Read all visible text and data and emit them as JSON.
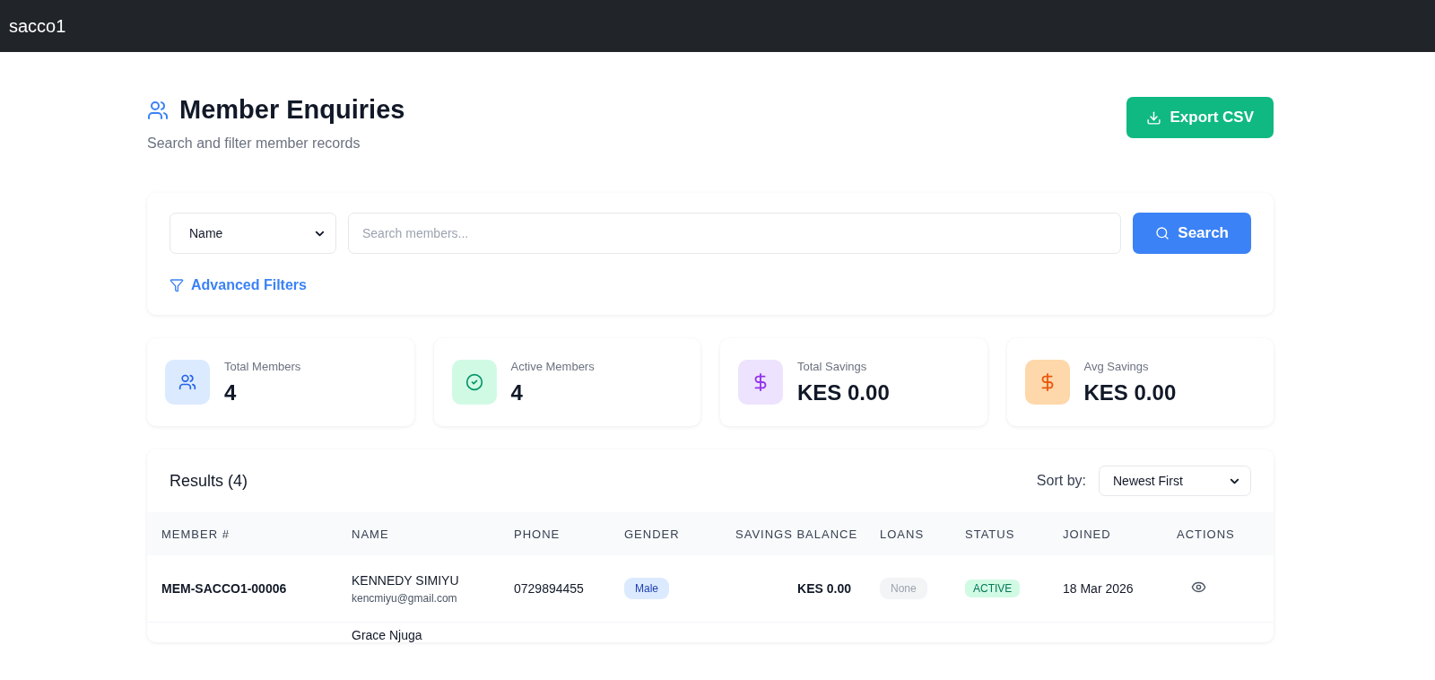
{
  "navbar": {
    "brand": "sacco1"
  },
  "header": {
    "title": "Member Enquiries",
    "subtitle": "Search and filter member records",
    "export_button": "Export CSV"
  },
  "search": {
    "field_select": "Name",
    "placeholder": "Search members...",
    "button": "Search",
    "advanced_filters": "Advanced Filters"
  },
  "stats": [
    {
      "label": "Total Members",
      "value": "4",
      "kind": "users",
      "color": "#dbeafe"
    },
    {
      "label": "Active Members",
      "value": "4",
      "kind": "check",
      "color": "#d1fae5"
    },
    {
      "label": "Total Savings",
      "value": "KES 0.00",
      "kind": "dollar",
      "color": "#ede3fe"
    },
    {
      "label": "Avg Savings",
      "value": "KES 0.00",
      "kind": "dollar",
      "color": "#fed7aa"
    }
  ],
  "results": {
    "title": "Results (4)",
    "sort_label": "Sort by:",
    "sort_value": "Newest First",
    "table": {
      "columns": [
        "MEMBER #",
        "NAME",
        "PHONE",
        "GENDER",
        "SAVINGS BALANCE",
        "LOANS",
        "STATUS",
        "JOINED",
        "ACTIONS"
      ],
      "rows": [
        {
          "member_no": "MEM-SACCO1-00006",
          "name": "KENNEDY SIMIYU",
          "email": "kencmiyu@gmail.com",
          "phone": "0729894455",
          "gender": "Male",
          "savings": "KES 0.00",
          "loans": "None",
          "status": "ACTIVE",
          "active": true,
          "joined": "18 Mar 2026",
          "view_action": true
        },
        {
          "name": "Grace Njuga"
        }
      ]
    }
  }
}
